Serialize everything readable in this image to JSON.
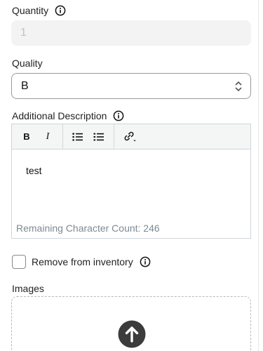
{
  "quantity": {
    "label": "Quantity",
    "value": "1"
  },
  "quality": {
    "label": "Quality",
    "selected": "B"
  },
  "description": {
    "label": "Additional Description",
    "toolbar": {
      "bold": "B",
      "italic": "I"
    },
    "content": "test",
    "remaining": "Remaining Character Count: 246"
  },
  "inventory": {
    "label": "Remove from inventory",
    "checked": false
  },
  "images": {
    "label": "Images"
  },
  "colors": {
    "field_bg": "#f3f3f3",
    "border": "#cfd6da",
    "muted_text": "#7e8a93",
    "upload_circle": "#3c3c3c"
  },
  "icons": {
    "info": "info-icon",
    "select": "chevron-up-down-icon",
    "bullet_list": "bullet-list-icon",
    "numbered_list": "numbered-list-icon",
    "link": "link-icon",
    "upload": "upload-arrow-icon"
  }
}
